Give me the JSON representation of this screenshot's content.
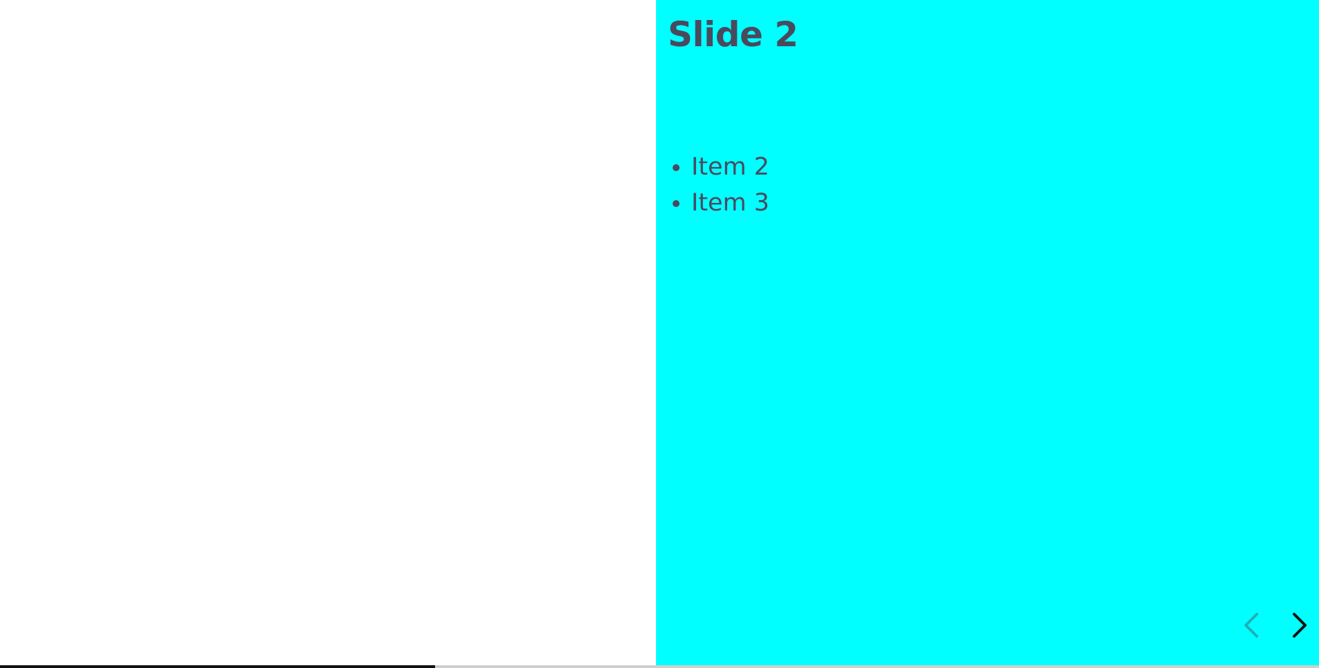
{
  "slide": {
    "title": "Slide 2",
    "items": [
      "Item 2",
      "Item 3"
    ],
    "background_color": "#00ffff",
    "text_color": "#4a4a5e"
  },
  "navigation": {
    "prev_icon": "chevron-left-icon",
    "next_icon": "chevron-right-icon",
    "prev_enabled": false,
    "next_enabled": true,
    "prev_color": "#1fb0b8",
    "next_color": "#111111"
  },
  "progress": {
    "fraction": 0.33,
    "fill_color": "#111111",
    "track_color": "#cfcfcf"
  }
}
